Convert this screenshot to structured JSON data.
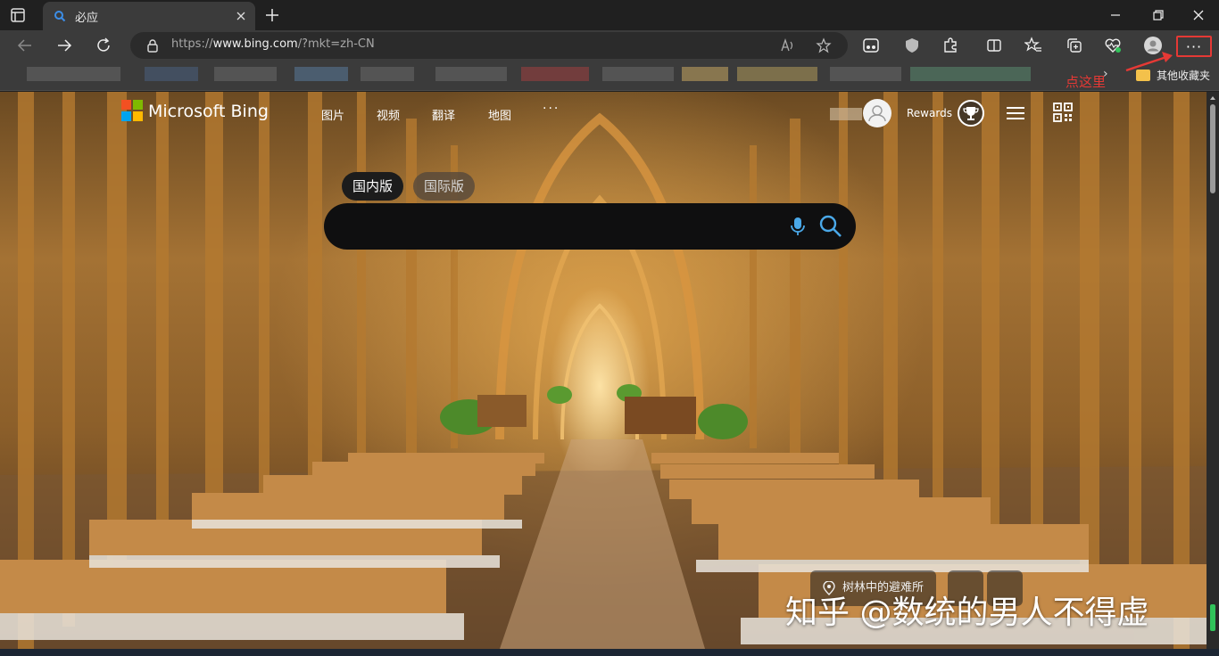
{
  "tabs": [
    {
      "title": "必应"
    }
  ],
  "toolbar": {
    "url_prefix": "https://",
    "url_host": "www.bing.com",
    "url_path": "/?mkt=zh-CN",
    "more_label": "···"
  },
  "favorites": {
    "other_folder": "其他收藏夹",
    "chevron": "›"
  },
  "annotation": {
    "text": "点这里"
  },
  "bing": {
    "brand": "Microsoft Bing",
    "nav": [
      "图片",
      "视频",
      "翻译",
      "地图"
    ],
    "nav_more": "···",
    "rewards": "Rewards",
    "tabs": {
      "domestic": "国内版",
      "international": "国际版"
    },
    "search_placeholder": "",
    "caption": "树林中的避难所"
  },
  "watermark": "知乎 @数统的男人不得虚",
  "colors": {
    "accent_red": "#e53935",
    "search_blue": "#4aa8e8"
  }
}
